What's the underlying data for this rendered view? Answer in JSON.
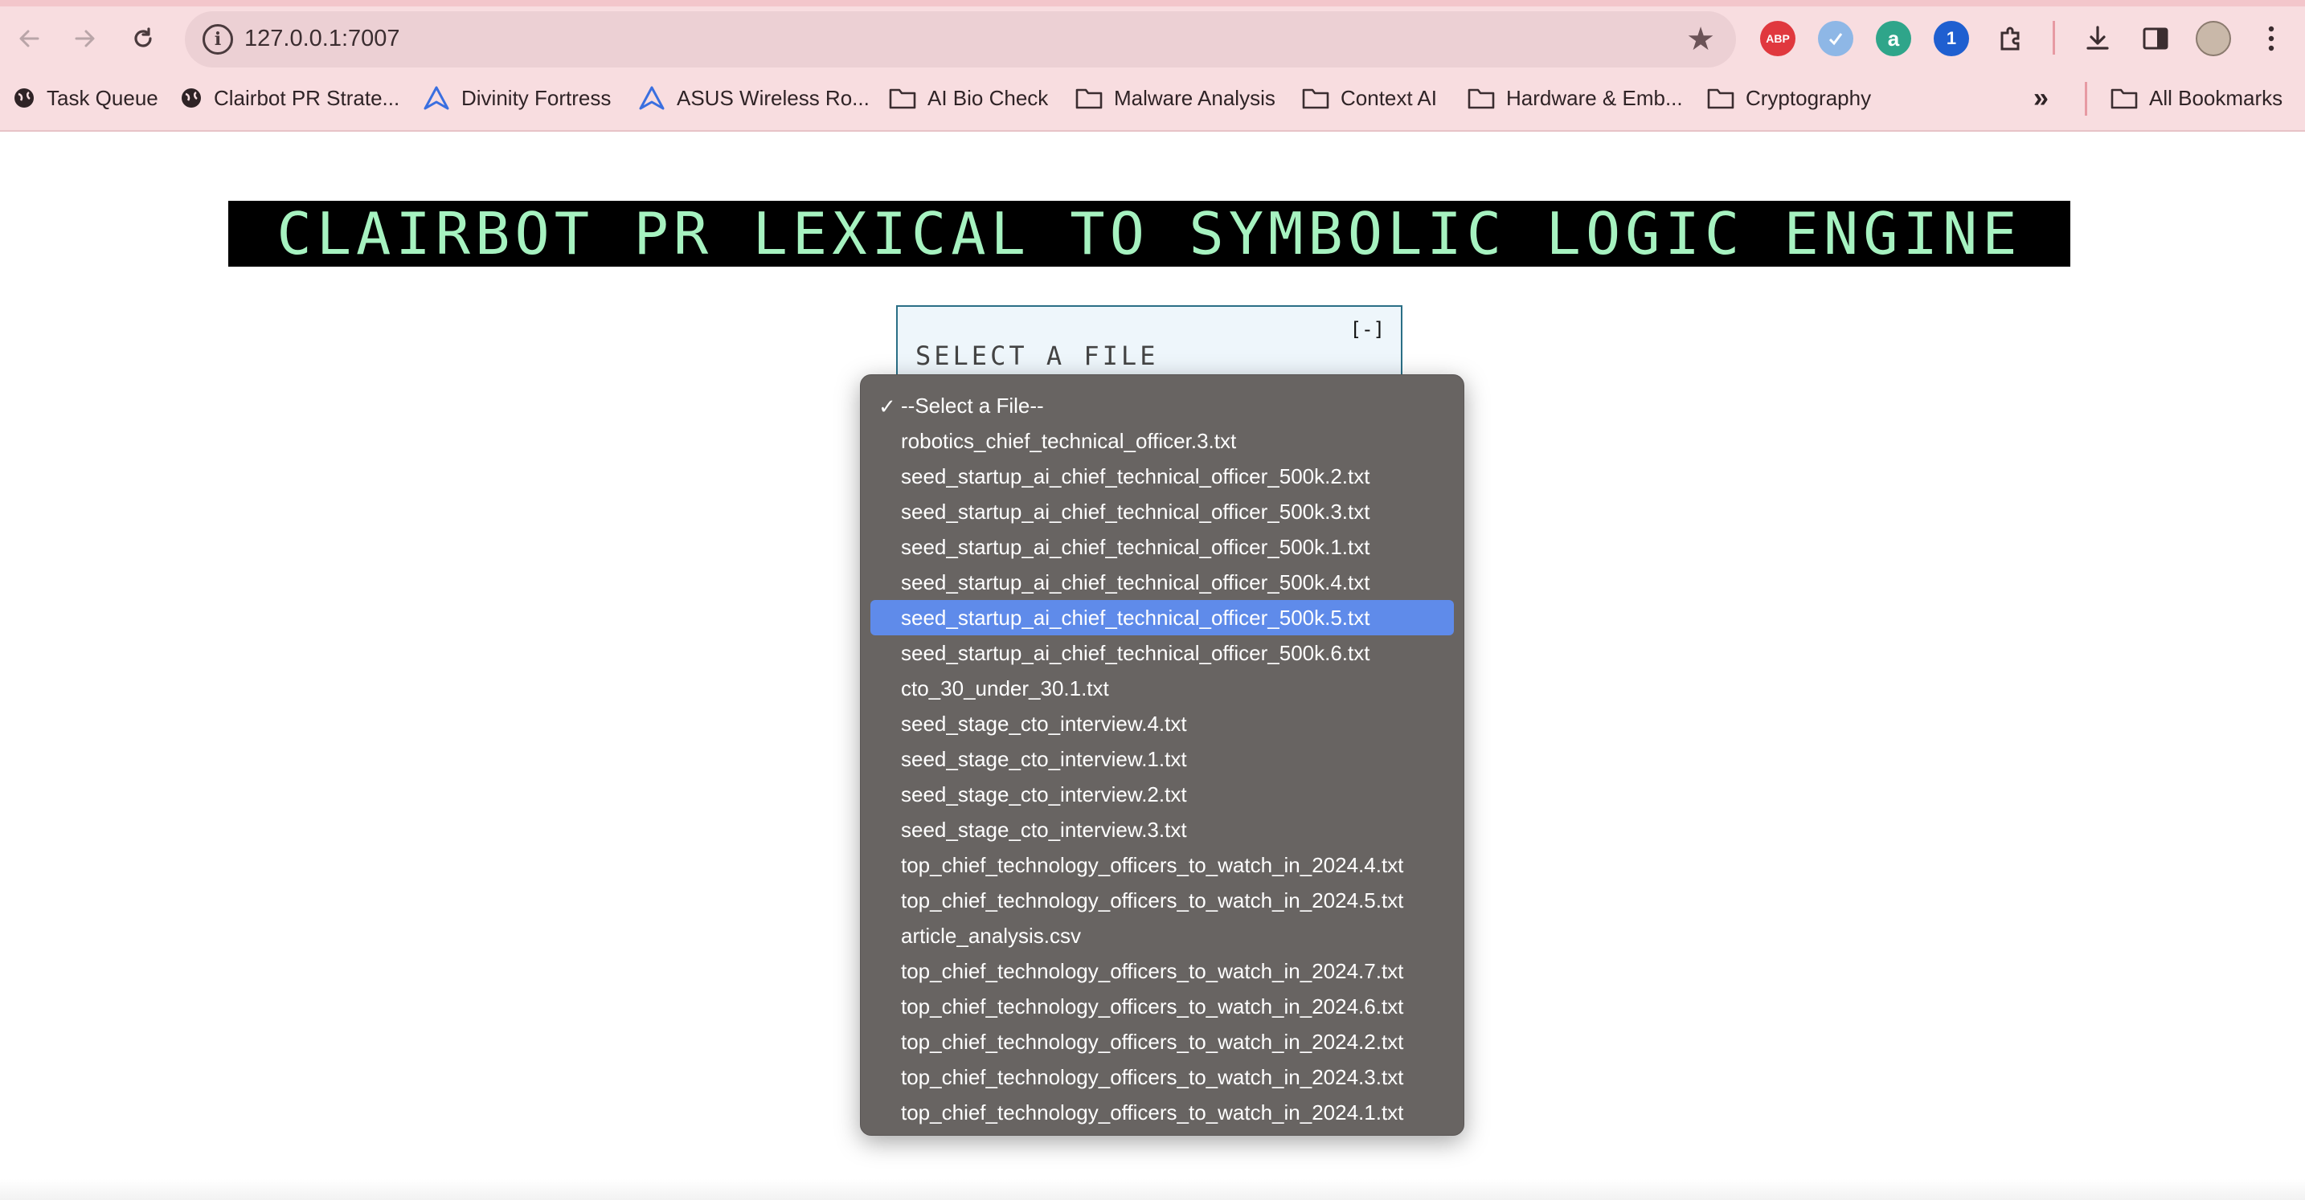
{
  "browser": {
    "url": "127.0.0.1:7007",
    "bookmarks": [
      {
        "label": "Task Queue",
        "icon": "globe-icon"
      },
      {
        "label": "Clairbot PR Strate...",
        "icon": "globe-icon"
      },
      {
        "label": "Divinity Fortress",
        "icon": "triangle-icon"
      },
      {
        "label": "ASUS Wireless Ro...",
        "icon": "triangle-icon"
      },
      {
        "label": "AI Bio Check",
        "icon": "folder-icon"
      },
      {
        "label": "Malware Analysis",
        "icon": "folder-icon"
      },
      {
        "label": "Context AI",
        "icon": "folder-icon"
      },
      {
        "label": "Hardware & Emb...",
        "icon": "folder-icon"
      },
      {
        "label": "Cryptography",
        "icon": "folder-icon"
      }
    ],
    "overflow_label": "»",
    "all_bookmarks_label": "All Bookmarks",
    "extensions": [
      "ABP",
      "",
      "a",
      "1",
      "",
      "",
      "",
      "",
      ""
    ]
  },
  "page": {
    "banner_title": "CLAIRBOT PR LEXICAL TO SYMBOLIC LOGIC ENGINE",
    "panel_toggle": "[-]",
    "panel_title": "SELECT A FILE"
  },
  "dropdown": {
    "selected_index": 0,
    "highlighted_index": 6,
    "options": [
      "--Select a File--",
      "robotics_chief_technical_officer.3.txt",
      "seed_startup_ai_chief_technical_officer_500k.2.txt",
      "seed_startup_ai_chief_technical_officer_500k.3.txt",
      "seed_startup_ai_chief_technical_officer_500k.1.txt",
      "seed_startup_ai_chief_technical_officer_500k.4.txt",
      "seed_startup_ai_chief_technical_officer_500k.5.txt",
      "seed_startup_ai_chief_technical_officer_500k.6.txt",
      "cto_30_under_30.1.txt",
      "seed_stage_cto_interview.4.txt",
      "seed_stage_cto_interview.1.txt",
      "seed_stage_cto_interview.2.txt",
      "seed_stage_cto_interview.3.txt",
      "top_chief_technology_officers_to_watch_in_2024.4.txt",
      "top_chief_technology_officers_to_watch_in_2024.5.txt",
      "article_analysis.csv",
      "top_chief_technology_officers_to_watch_in_2024.7.txt",
      "top_chief_technology_officers_to_watch_in_2024.6.txt",
      "top_chief_technology_officers_to_watch_in_2024.2.txt",
      "top_chief_technology_officers_to_watch_in_2024.3.txt",
      "top_chief_technology_officers_to_watch_in_2024.1.txt"
    ]
  },
  "colors": {
    "chrome_bg": "#f8dde0",
    "banner_bg": "#000000",
    "banner_text": "#a6f2c0",
    "dropdown_bg": "#686462",
    "highlight": "#5f8bea"
  }
}
